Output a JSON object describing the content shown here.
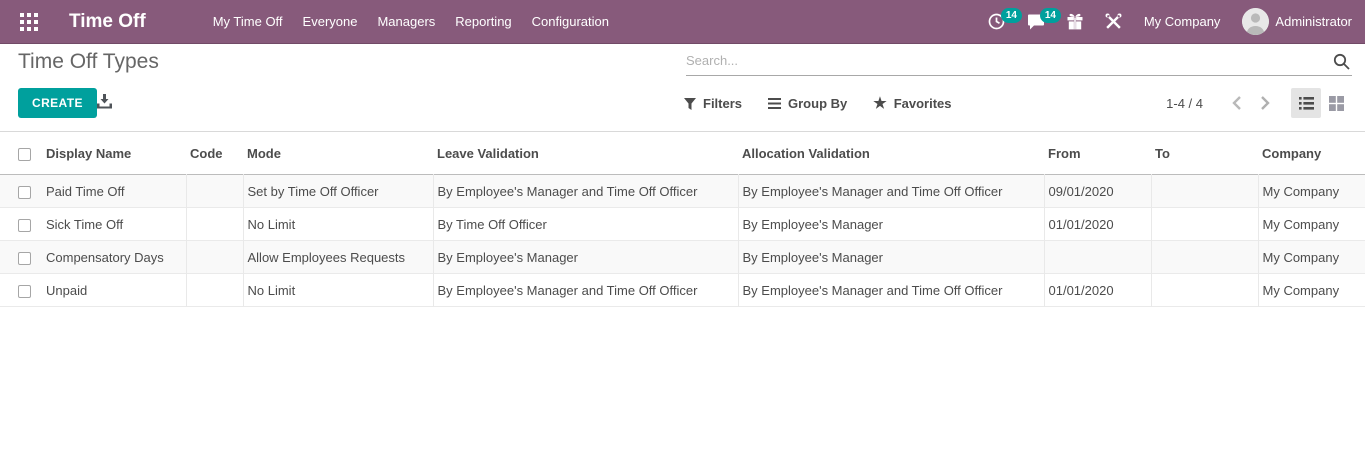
{
  "colors": {
    "navbar_bg": "#875A7B",
    "primary": "#00A09D",
    "badge_bg": "#00A09D"
  },
  "icons": {
    "star": "★"
  },
  "navbar": {
    "app_title": "Time Off",
    "menu": [
      {
        "label": "My Time Off"
      },
      {
        "label": "Everyone"
      },
      {
        "label": "Managers"
      },
      {
        "label": "Reporting"
      },
      {
        "label": "Configuration"
      }
    ],
    "activities_badge": "14",
    "messages_badge": "14",
    "company_label": "My Company",
    "user_label": "Administrator"
  },
  "control_panel": {
    "title": "Time Off Types",
    "search_placeholder": "Search...",
    "create_label": "CREATE",
    "filters_label": "Filters",
    "group_by_label": "Group By",
    "favorites_label": "Favorites",
    "pager": "1-4 / 4"
  },
  "table": {
    "columns": [
      "Display Name",
      "Code",
      "Mode",
      "Leave Validation",
      "Allocation Validation",
      "From",
      "To",
      "Company"
    ],
    "rows": [
      {
        "display_name": "Paid Time Off",
        "code": "",
        "mode": "Set by Time Off Officer",
        "leave_validation": "By Employee's Manager and Time Off Officer",
        "allocation_validation": "By Employee's Manager and Time Off Officer",
        "from": "09/01/2020",
        "to": "",
        "company": "My Company"
      },
      {
        "display_name": "Sick Time Off",
        "code": "",
        "mode": "No Limit",
        "leave_validation": "By Time Off Officer",
        "allocation_validation": "By Employee's Manager",
        "from": "01/01/2020",
        "to": "",
        "company": "My Company"
      },
      {
        "display_name": "Compensatory Days",
        "code": "",
        "mode": "Allow Employees Requests",
        "leave_validation": "By Employee's Manager",
        "allocation_validation": "By Employee's Manager",
        "from": "",
        "to": "",
        "company": "My Company"
      },
      {
        "display_name": "Unpaid",
        "code": "",
        "mode": "No Limit",
        "leave_validation": "By Employee's Manager and Time Off Officer",
        "allocation_validation": "By Employee's Manager and Time Off Officer",
        "from": "01/01/2020",
        "to": "",
        "company": "My Company"
      }
    ]
  }
}
